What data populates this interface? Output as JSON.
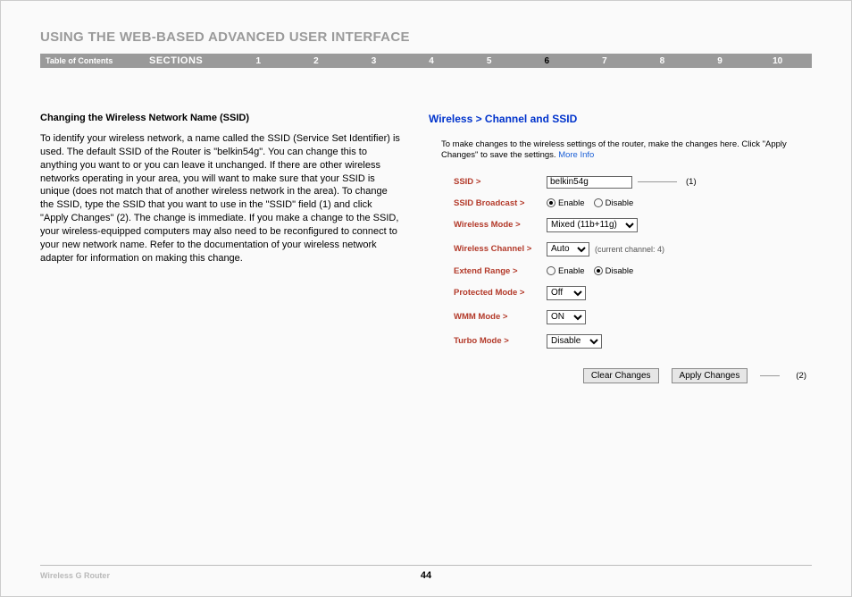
{
  "title": "USING THE WEB-BASED ADVANCED USER INTERFACE",
  "nav": {
    "toc": "Table of Contents",
    "sections": "SECTIONS",
    "nums": [
      "1",
      "2",
      "3",
      "4",
      "5",
      "6",
      "7",
      "8",
      "9",
      "10"
    ],
    "active": "6"
  },
  "section": {
    "heading": "Changing the Wireless Network Name (SSID)",
    "body": "To identify your wireless network, a name called the SSID (Service Set Identifier) is used. The default SSID of the Router is \"belkin54g\". You can change this to anything you want to or you can leave it unchanged. If there are other wireless networks operating in your area, you will want to make sure that your SSID is unique (does not match that of another wireless network in the area). To change the SSID, type the SSID that you want to use in the \"SSID\" field (1) and click \"Apply Changes\" (2). The change is immediate. If you make a change to the SSID, your wireless-equipped computers may also need to be reconfigured to connect to your new network name. Refer to the documentation of your wireless network adapter for information on making this change."
  },
  "panel": {
    "breadcrumb": "Wireless > Channel and SSID",
    "desc": "To make changes to the wireless settings of the router, make the changes here. Click \"Apply Changes\" to save the settings. ",
    "more_info": "More Info",
    "fields": {
      "ssid": {
        "label": "SSID",
        "value": "belkin54g",
        "callout": "(1)"
      },
      "broadcast": {
        "label": "SSID Broadcast",
        "enable": "Enable",
        "disable": "Disable"
      },
      "mode": {
        "label": "Wireless Mode",
        "value": "Mixed (11b+11g)"
      },
      "channel": {
        "label": "Wireless Channel",
        "value": "Auto",
        "note": "(current channel: 4)"
      },
      "extend": {
        "label": "Extend Range",
        "enable": "Enable",
        "disable": "Disable"
      },
      "protected": {
        "label": "Protected Mode",
        "value": "Off"
      },
      "wmm": {
        "label": "WMM Mode",
        "value": "ON"
      },
      "turbo": {
        "label": "Turbo Mode",
        "value": "Disable"
      }
    },
    "buttons": {
      "clear": "Clear Changes",
      "apply": "Apply Changes",
      "callout": "(2)"
    }
  },
  "footer": {
    "product": "Wireless G Router",
    "page": "44"
  }
}
